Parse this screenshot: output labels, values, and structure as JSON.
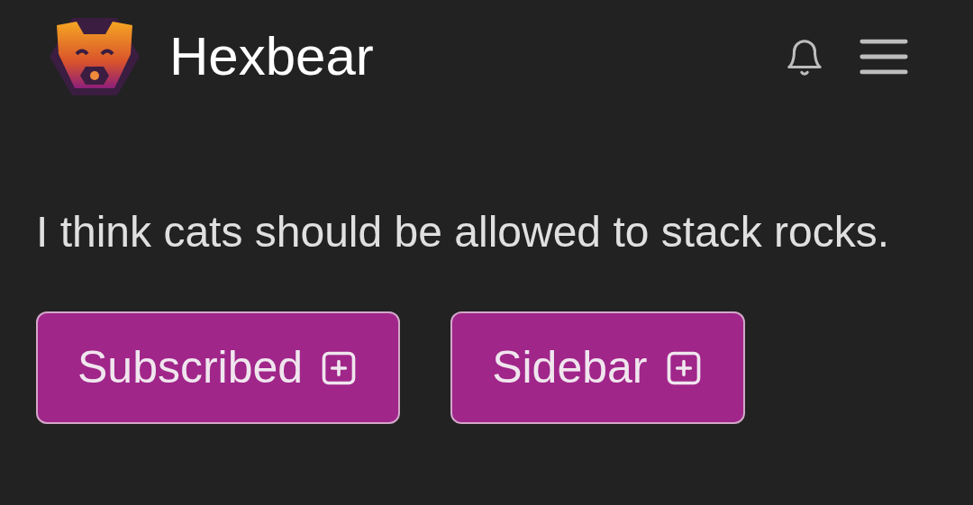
{
  "header": {
    "site_name": "Hexbear"
  },
  "description": "I think cats should be allowed to stack rocks.",
  "buttons": [
    {
      "label": "Subscribed"
    },
    {
      "label": "Sidebar"
    }
  ]
}
